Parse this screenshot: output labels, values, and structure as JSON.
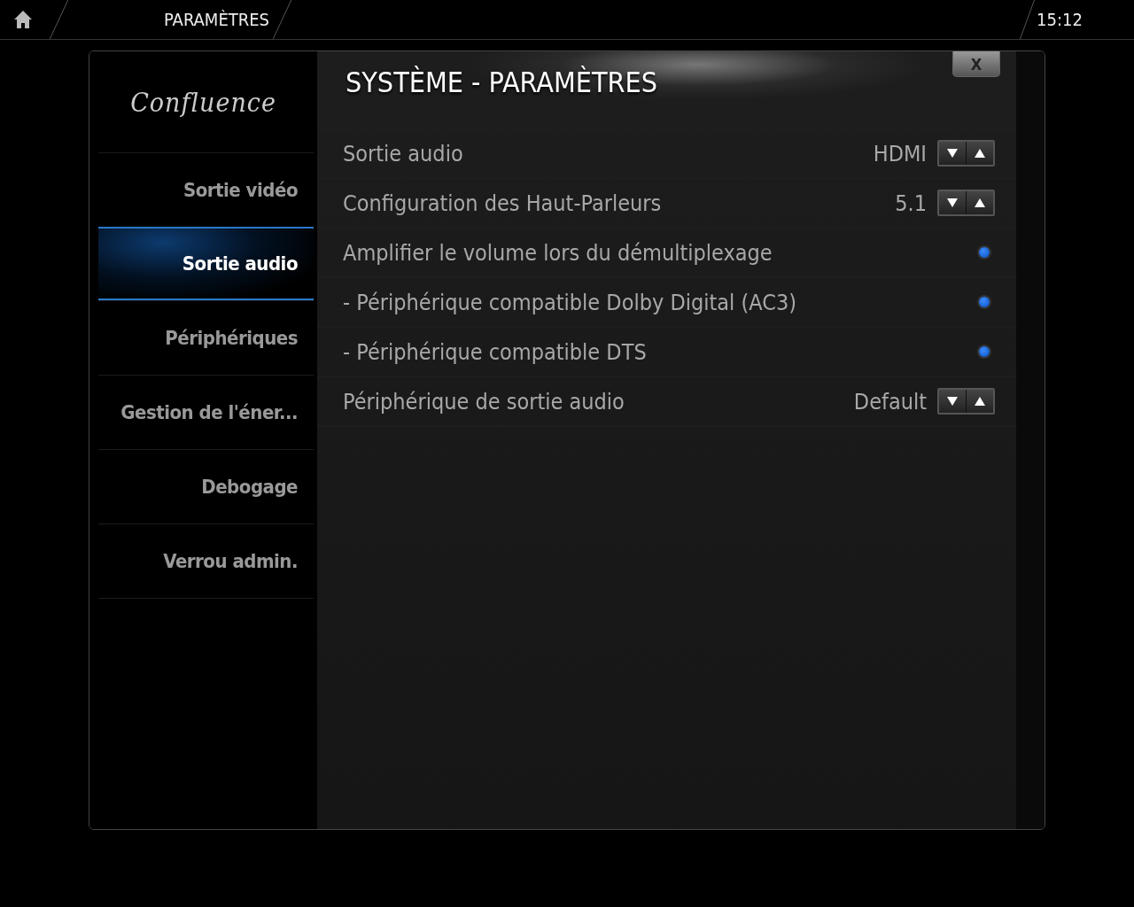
{
  "top_bar": {
    "title": "PARAMÈTRES",
    "clock": "15:12"
  },
  "logo": "Confluence",
  "sidebar": {
    "items": [
      {
        "label": "Sortie vidéo",
        "selected": false
      },
      {
        "label": "Sortie audio",
        "selected": true
      },
      {
        "label": "Périphériques",
        "selected": false
      },
      {
        "label": "Gestion de l'éner...",
        "selected": false
      },
      {
        "label": "Debogage",
        "selected": false
      },
      {
        "label": "Verrou admin.",
        "selected": false
      }
    ]
  },
  "panel": {
    "title": "SYSTÈME - PARAMÈTRES",
    "close": "X"
  },
  "settings": [
    {
      "kind": "spin",
      "label": "Sortie audio",
      "value": "HDMI"
    },
    {
      "kind": "spin",
      "label": "Configuration des Haut-Parleurs",
      "value": "5.1"
    },
    {
      "kind": "toggle",
      "label": "Amplifier le volume lors du démultiplexage",
      "on": true
    },
    {
      "kind": "toggle",
      "label": "- Périphérique compatible Dolby Digital (AC3)",
      "on": true
    },
    {
      "kind": "toggle",
      "label": "- Périphérique compatible DTS",
      "on": true
    },
    {
      "kind": "spin",
      "label": "Périphérique de sortie audio",
      "value": "Default"
    }
  ]
}
